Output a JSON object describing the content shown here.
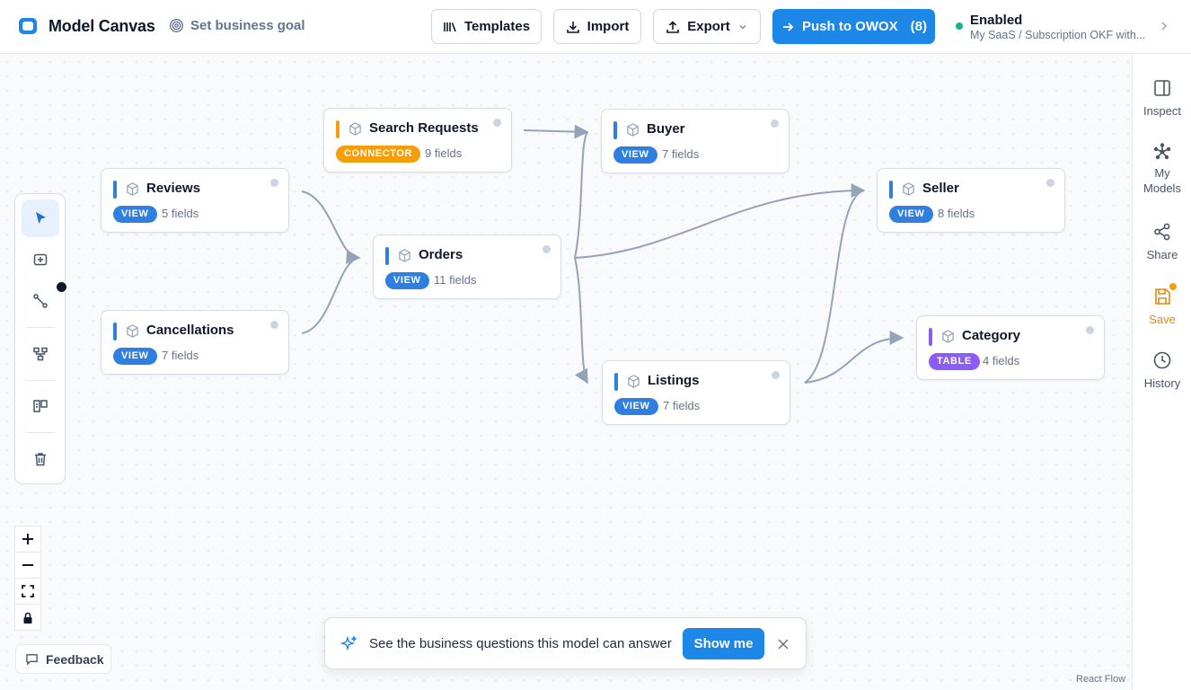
{
  "header": {
    "app_title": "Model Canvas",
    "goal_label": "Set business goal",
    "templates_label": "Templates",
    "import_label": "Import",
    "export_label": "Export",
    "push_label": "Push to OWOX",
    "push_count": "(8)",
    "status_title": "Enabled",
    "status_subtitle": "My SaaS / Subscription OKF with..."
  },
  "nodes": [
    {
      "name": "Search Requests",
      "badge": "CONNECTOR",
      "fields": "9 fields",
      "accent": "#f59e0b",
      "badge_color": "#f59e0b"
    },
    {
      "name": "Buyer",
      "badge": "VIEW",
      "fields": "7 fields",
      "accent": "#2f7fe0",
      "badge_color": "#2f7fe0"
    },
    {
      "name": "Reviews",
      "badge": "VIEW",
      "fields": "5 fields",
      "accent": "#2f7fe0",
      "badge_color": "#2f7fe0"
    },
    {
      "name": "Seller",
      "badge": "VIEW",
      "fields": "8 fields",
      "accent": "#2f7fe0",
      "badge_color": "#2f7fe0"
    },
    {
      "name": "Orders",
      "badge": "VIEW",
      "fields": "11 fields",
      "accent": "#2f7fe0",
      "badge_color": "#2f7fe0"
    },
    {
      "name": "Cancellations",
      "badge": "VIEW",
      "fields": "7 fields",
      "accent": "#2f7fe0",
      "badge_color": "#2f7fe0"
    },
    {
      "name": "Category",
      "badge": "TABLE",
      "fields": "4 fields",
      "accent": "#8b5cf6",
      "badge_color": "#8b5cf6"
    },
    {
      "name": "Listings",
      "badge": "VIEW",
      "fields": "7 fields",
      "accent": "#2f7fe0",
      "badge_color": "#2f7fe0"
    }
  ],
  "banner": {
    "message": "See the business questions this model can answer",
    "button": "Show me"
  },
  "feedback_label": "Feedback",
  "watermark": "React Flow",
  "sidebar": {
    "inspect": "Inspect",
    "my_models_1": "My",
    "my_models_2": "Models",
    "share": "Share",
    "save": "Save",
    "history": "History"
  },
  "colors": {
    "primary": "#1d87e8",
    "connector": "#f59e0b",
    "view": "#2f7fe0",
    "table": "#8b5cf6",
    "enabled": "#10b981",
    "save": "#e28a0a"
  }
}
